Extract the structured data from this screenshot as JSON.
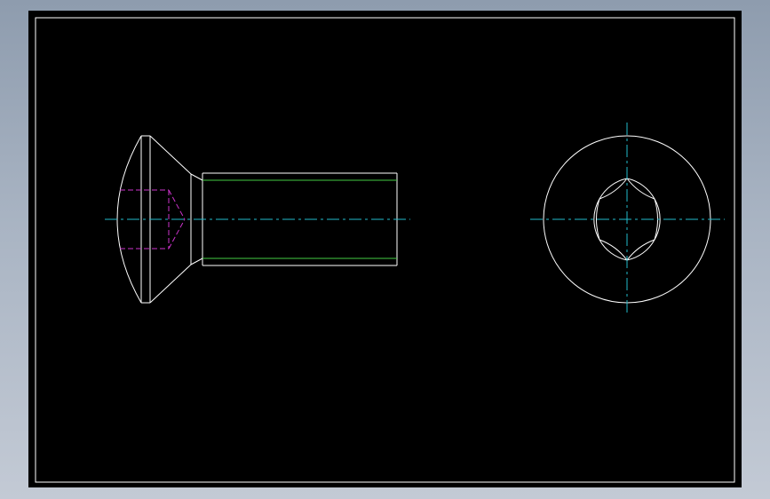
{
  "colors": {
    "background_gradient_top": "#8e9cae",
    "background_gradient_bottom": "#c3cad5",
    "viewport": "#000000",
    "frame": "#ffffff",
    "outline": "#ffffff",
    "thread": "#44cc44",
    "hidden_recess": "#cc33cc",
    "centerline": "#22bbcc"
  },
  "views": [
    {
      "name": "side-view",
      "part": "countersunk-screw",
      "features": [
        "oval-countersunk-head",
        "threaded-shank",
        "hidden-drive-recess",
        "axis-centerline"
      ]
    },
    {
      "name": "end-view",
      "part": "screw-head",
      "features": [
        "head-circle",
        "hexalobular-drive-recess",
        "crosshair-centerlines"
      ]
    }
  ]
}
